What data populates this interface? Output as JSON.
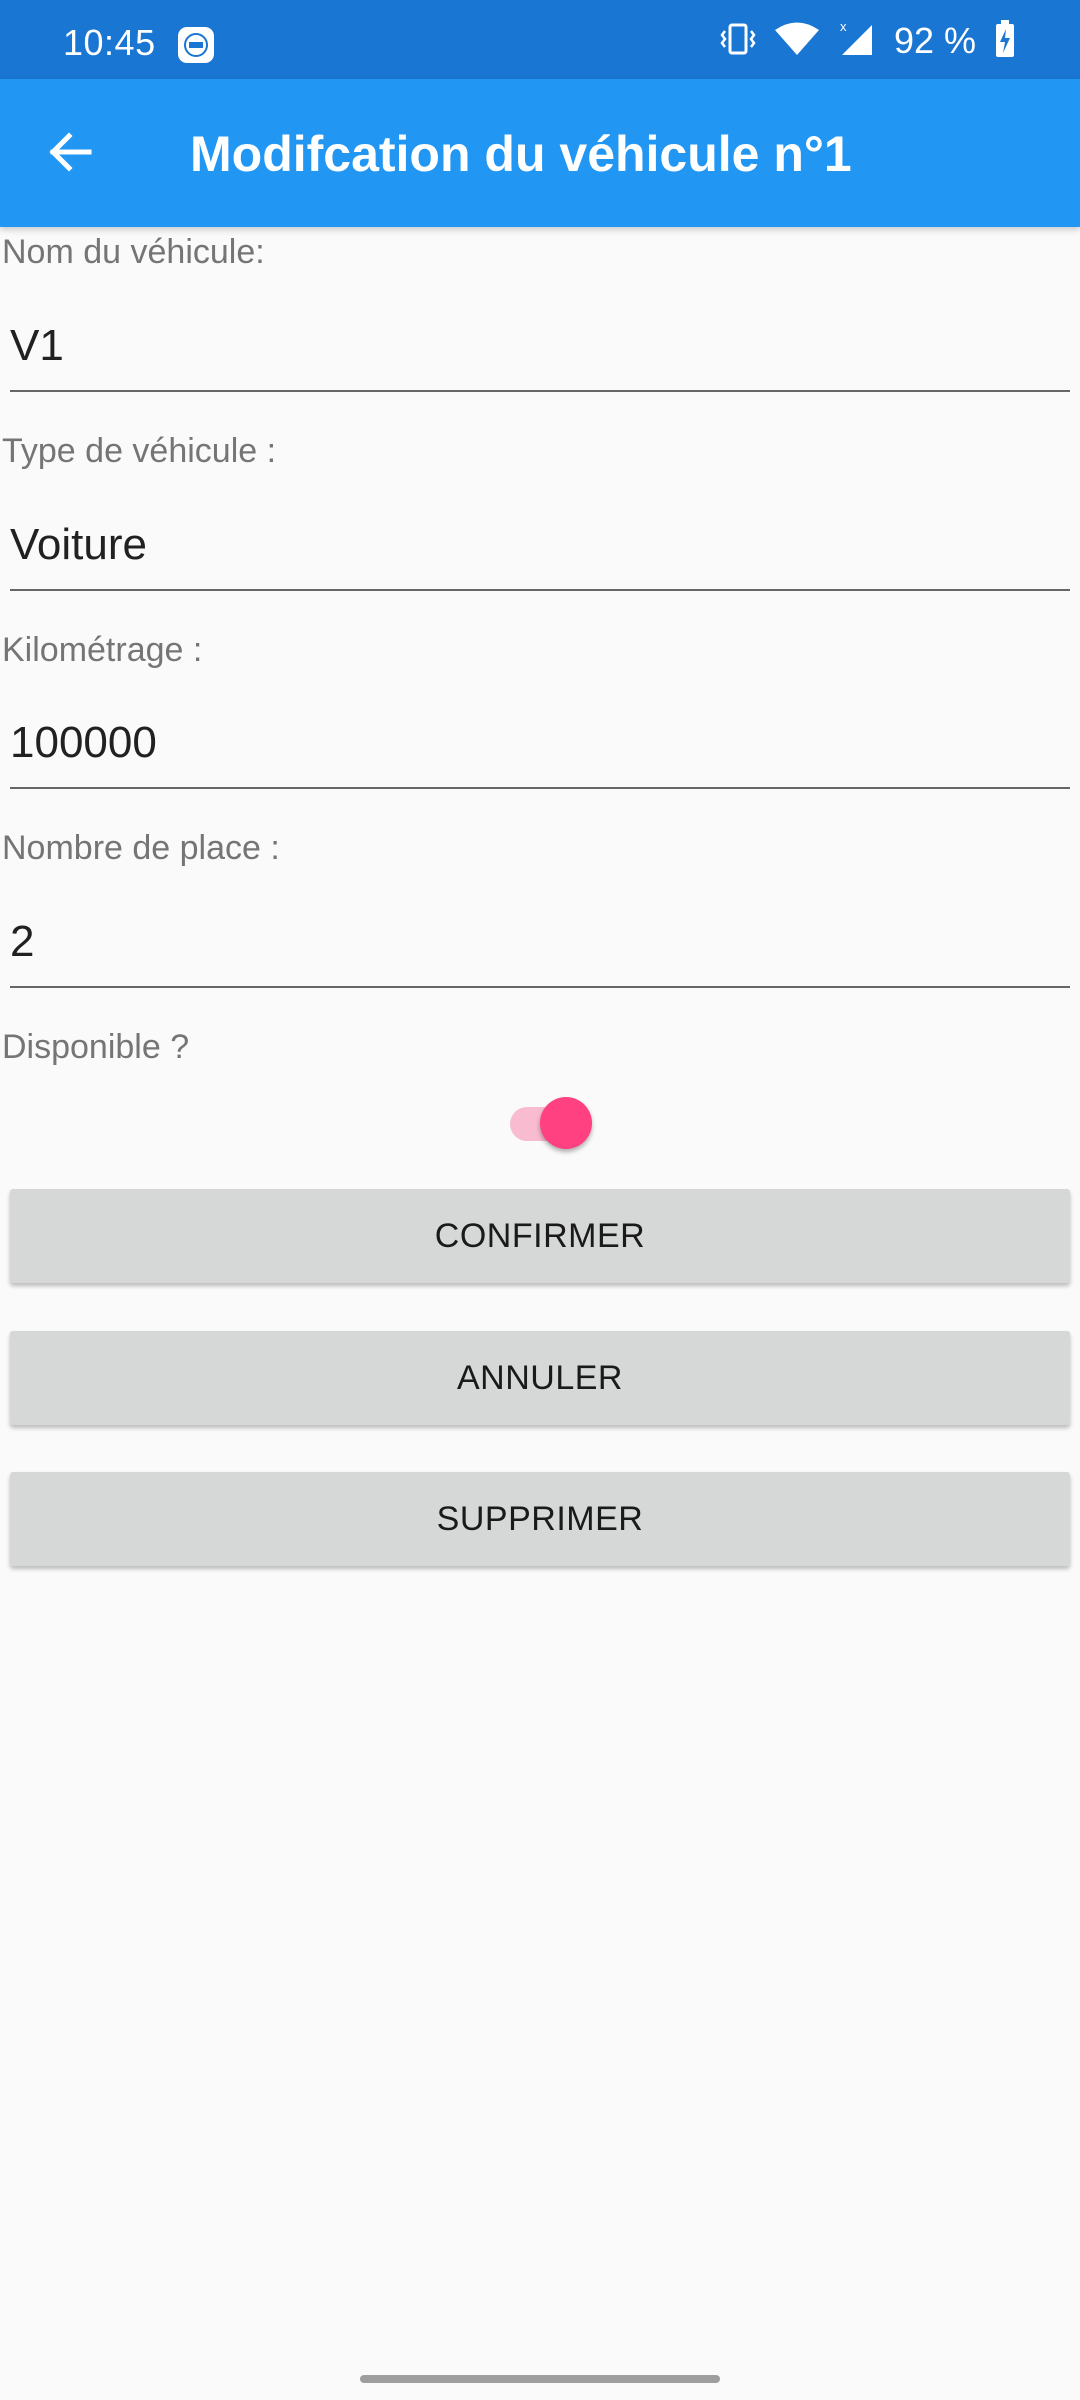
{
  "status_bar": {
    "time": "10:45",
    "battery_text": "92 %",
    "icons": [
      "app-notification-icon",
      "vibrate-icon",
      "wifi-icon",
      "cell-signal-icon",
      "battery-charging-icon"
    ]
  },
  "app_bar": {
    "back_icon": "arrow-left-icon",
    "title": "Modifcation du véhicule n°1"
  },
  "form": {
    "name": {
      "label": "Nom du véhicule:",
      "value": "V1"
    },
    "type": {
      "label": "Type de véhicule :",
      "value": "Voiture"
    },
    "mileage": {
      "label": "Kilométrage :",
      "value": "100000"
    },
    "seats": {
      "label": "Nombre de place :",
      "value": "2"
    },
    "available": {
      "label": "Disponible ?",
      "checked": true
    }
  },
  "buttons": {
    "confirm": "CONFIRMER",
    "cancel": "ANNULER",
    "delete": "SUPPRIMER"
  },
  "colors": {
    "status_bar": "#1976d2",
    "app_bar": "#2196f3",
    "switch_accent": "#ff4081",
    "button_bg": "#d6d7d7"
  }
}
